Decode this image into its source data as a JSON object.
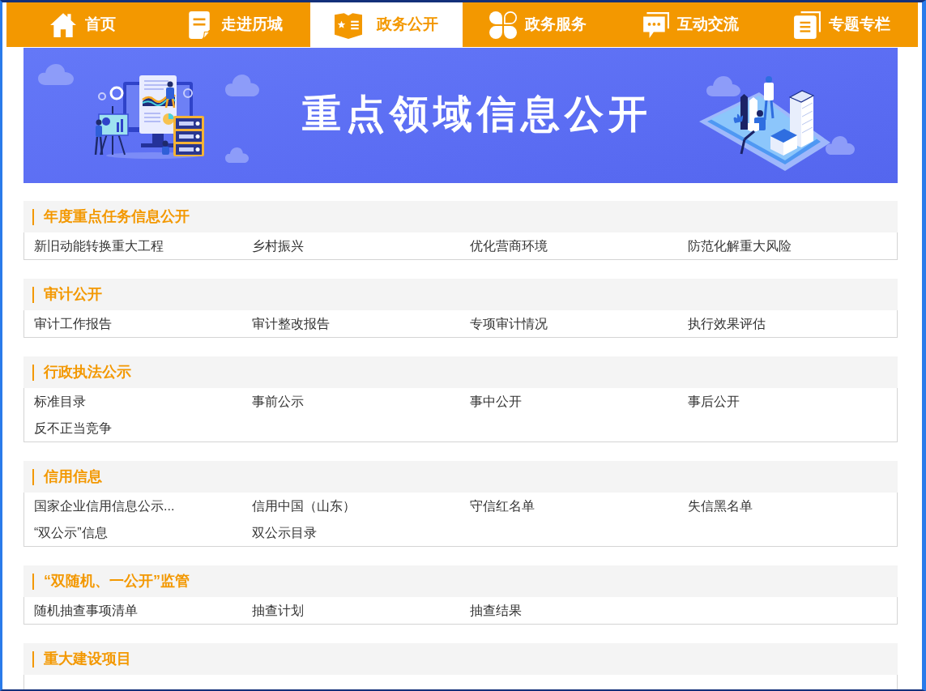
{
  "nav": {
    "tabs": [
      {
        "label": "首页",
        "selected": false
      },
      {
        "label": "走进历城",
        "selected": false
      },
      {
        "label": "政务公开",
        "selected": true
      },
      {
        "label": "政务服务",
        "selected": false
      },
      {
        "label": "互动交流",
        "selected": false
      },
      {
        "label": "专题专栏",
        "selected": false
      }
    ]
  },
  "banner": {
    "title": "重点领域信息公开"
  },
  "sections": [
    {
      "title": "年度重点任务信息公开",
      "links": [
        "新旧动能转换重大工程",
        "乡村振兴",
        "优化营商环境",
        "防范化解重大风险"
      ]
    },
    {
      "title": "审计公开",
      "links": [
        "审计工作报告",
        "审计整改报告",
        "专项审计情况",
        "执行效果评估"
      ]
    },
    {
      "title": "行政执法公示",
      "links": [
        "标准目录",
        "事前公示",
        "事中公开",
        "事后公开",
        "反不正当竞争"
      ]
    },
    {
      "title": "信用信息",
      "links": [
        "国家企业信用信息公示...",
        "信用中国（山东）",
        "守信红名单",
        "失信黑名单",
        "“双公示”信息",
        "双公示目录"
      ]
    },
    {
      "title": "“双随机、一公开”监管",
      "links": [
        "随机抽查事项清单",
        "抽查计划",
        "抽查结果"
      ]
    },
    {
      "title": "重大建设项目"
    }
  ]
}
